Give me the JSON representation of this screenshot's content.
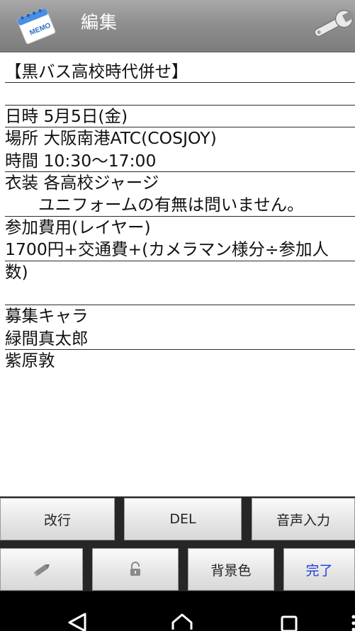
{
  "header": {
    "title": "編集",
    "app_icon": "memo-icon",
    "settings_icon": "wrench-icon",
    "memo_icon_label": "MEMO"
  },
  "memo": {
    "lines": [
      "【黒バス高校時代併せ】",
      "",
      "日時 5月5日(金)",
      "場所 大阪南港ATC(COSJOY)",
      "時間 10:30〜17:00",
      "衣装 各高校ジャージ",
      "　　ユニフォームの有無は問いません。",
      "参加費用(レイヤー)",
      "1700円+交通費+(カメラマン様分÷参加人",
      "数)",
      "",
      "募集キャラ",
      "緑間真太郎",
      "紫原敦"
    ]
  },
  "toolbar": {
    "newline_label": "改行",
    "delete_label": "DEL",
    "voice_input_label": "音声入力",
    "pen_icon": "pencil-icon",
    "lock_icon": "lock-icon",
    "background_color_label": "背景色",
    "done_label": "完了"
  },
  "colors": {
    "title_bar": "#8f8f8f",
    "done_text": "#1a3be0",
    "panel_bg": "#262626"
  },
  "navbar": {
    "back_icon": "back-triangle-icon",
    "home_icon": "home-icon",
    "recents_icon": "recents-square-icon"
  }
}
